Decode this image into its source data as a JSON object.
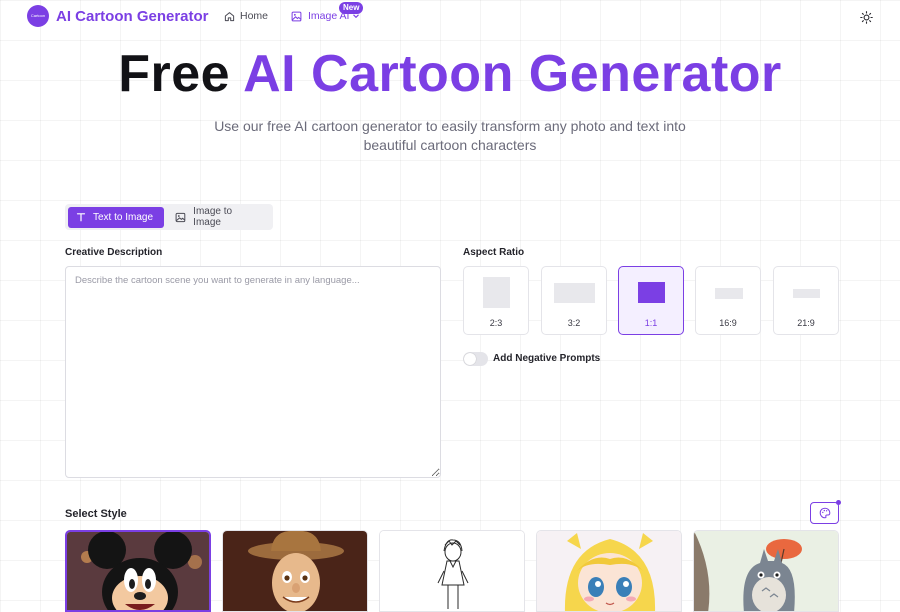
{
  "header": {
    "logo_text": "Cartoon",
    "brand_title": "AI Cartoon Generator",
    "nav": {
      "home_label": "Home",
      "image_ai_label": "Image AI",
      "new_badge": "New"
    }
  },
  "hero": {
    "title_plain": "Free",
    "title_accent": "AI Cartoon Generator",
    "subtitle": "Use our free AI cartoon generator to easily transform any photo and text into beautiful cartoon characters"
  },
  "mode_tabs": [
    {
      "label": "Text to Image",
      "active": true
    },
    {
      "label": "Image to Image",
      "active": false
    }
  ],
  "creative": {
    "label": "Creative Description",
    "placeholder": "Describe the cartoon scene you want to generate in any language...",
    "value": ""
  },
  "aspect": {
    "label": "Aspect Ratio",
    "options": [
      {
        "label": "2:3",
        "selected": false
      },
      {
        "label": "3:2",
        "selected": false
      },
      {
        "label": "1:1",
        "selected": true
      },
      {
        "label": "16:9",
        "selected": false
      },
      {
        "label": "21:9",
        "selected": false
      }
    ]
  },
  "negative_prompts": {
    "label": "Add Negative Prompts",
    "enabled": false
  },
  "style": {
    "label": "Select Style",
    "selected_index": 0,
    "thumbnails": [
      "mickey-style",
      "3d-cowboy-style",
      "line-sketch-style",
      "anime-style",
      "totoro-watercolor-style"
    ]
  },
  "colors": {
    "accent": "#7b3fe4",
    "text_dark": "#121216",
    "muted": "#6b6b7a"
  }
}
